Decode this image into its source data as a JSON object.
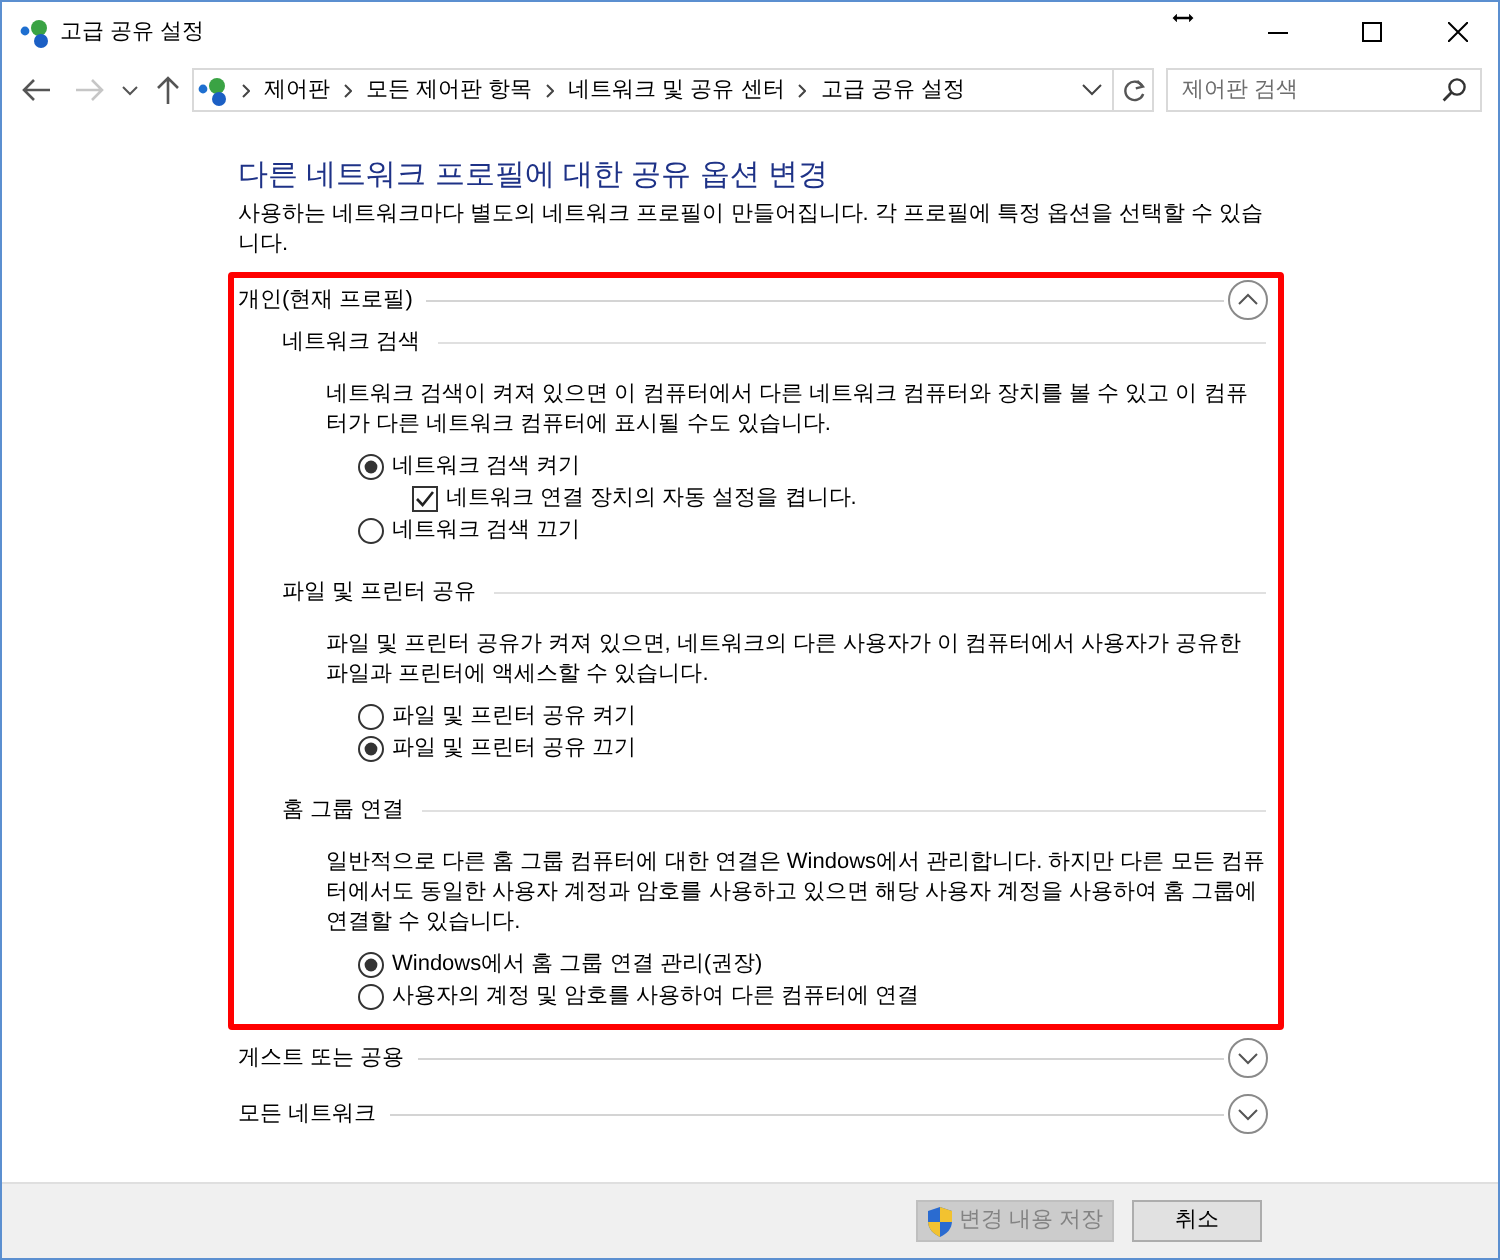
{
  "window": {
    "title": "고급 공유 설정"
  },
  "nav_buttons": [
    {
      "kind": "back",
      "disabled": false
    },
    {
      "kind": "forward",
      "disabled": true
    },
    {
      "kind": "recent",
      "disabled": false
    },
    {
      "kind": "up",
      "disabled": false
    }
  ],
  "address_bar": {
    "breadcrumbs": [
      "제어판",
      "모든 제어판 항목",
      "네트워크 및 공유 센터",
      "고급 공유 설정"
    ]
  },
  "search": {
    "placeholder": "제어판 검색"
  },
  "heading": "다른 네트워크 프로필에 대한 공유 옵션 변경",
  "intro": "사용하는 네트워크마다 별도의 네트워크 프로필이 만들어집니다. 각 프로필에 특정 옵션을 선택할 수 있습니다.",
  "profiles": [
    {
      "title": "개인(현재 프로필)",
      "expanded": true,
      "highlighted": true,
      "sections": [
        {
          "title": "네트워크 검색",
          "description": "네트워크 검색이 켜져 있으면 이 컴퓨터에서 다른 네트워크 컴퓨터와 장치를 볼 수 있고 이 컴퓨터가 다른 네트워크 컴퓨터에 표시될 수도 있습니다.",
          "options": [
            {
              "kind": "radio",
              "label": "네트워크 검색 켜기",
              "selected": true,
              "children": [
                {
                  "kind": "checkbox",
                  "label": "네트워크 연결 장치의 자동 설정을 켭니다.",
                  "checked": true
                }
              ]
            },
            {
              "kind": "radio",
              "label": "네트워크 검색 끄기",
              "selected": false
            }
          ]
        },
        {
          "title": "파일 및 프린터 공유",
          "description": "파일 및 프린터 공유가 켜져 있으면, 네트워크의 다른 사용자가 이 컴퓨터에서 사용자가 공유한 파일과 프린터에 액세스할 수 있습니다.",
          "options": [
            {
              "kind": "radio",
              "label": "파일 및 프린터 공유 켜기",
              "selected": false
            },
            {
              "kind": "radio",
              "label": "파일 및 프린터 공유 끄기",
              "selected": true
            }
          ]
        },
        {
          "title": "홈 그룹 연결",
          "description": "일반적으로 다른 홈 그룹 컴퓨터에 대한 연결은 Windows에서 관리합니다. 하지만 다른 모든 컴퓨터에서도 동일한 사용자 계정과 암호를 사용하고 있으면 해당 사용자 계정을 사용하여 홈 그룹에 연결할 수 있습니다.",
          "options": [
            {
              "kind": "radio",
              "label": "Windows에서 홈 그룹 연결 관리(권장)",
              "selected": true
            },
            {
              "kind": "radio",
              "label": "사용자의 계정 및 암호를 사용하여 다른 컴퓨터에 연결",
              "selected": false
            }
          ]
        }
      ]
    },
    {
      "title": "게스트 또는 공용",
      "expanded": false,
      "highlighted": false
    },
    {
      "title": "모든 네트워크",
      "expanded": false,
      "highlighted": false
    }
  ],
  "buttons": [
    {
      "label": "변경 내용 저장",
      "kind": "elevated",
      "disabled": true
    },
    {
      "label": "취소",
      "kind": "plain",
      "disabled": false
    }
  ]
}
